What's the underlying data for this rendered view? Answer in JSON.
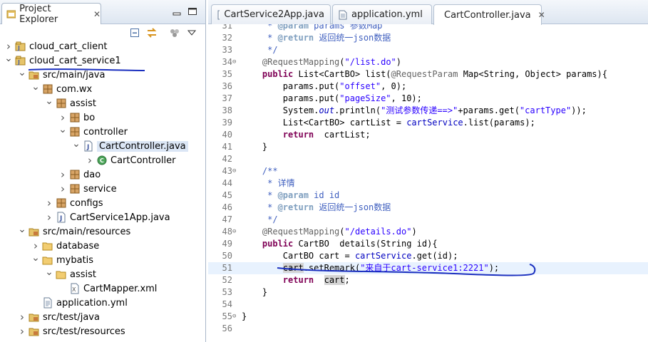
{
  "explorer": {
    "title": "Project Explorer",
    "tree": [
      {
        "label": "cloud_cart_client",
        "depth": 0,
        "arrow": "collapsed",
        "icon": "project-icon"
      },
      {
        "label": "cloud_cart_service1",
        "depth": 0,
        "arrow": "expanded",
        "icon": "project-icon"
      },
      {
        "label": "src/main/java",
        "depth": 1,
        "arrow": "expanded",
        "icon": "source-folder-icon"
      },
      {
        "label": "com.wx",
        "depth": 2,
        "arrow": "expanded",
        "icon": "package-icon"
      },
      {
        "label": "assist",
        "depth": 3,
        "arrow": "expanded",
        "icon": "package-icon"
      },
      {
        "label": "bo",
        "depth": 4,
        "arrow": "collapsed",
        "icon": "package-icon"
      },
      {
        "label": "controller",
        "depth": 4,
        "arrow": "expanded",
        "icon": "package-icon"
      },
      {
        "label": "CartController.java",
        "depth": 5,
        "arrow": "expanded",
        "icon": "java-file-icon",
        "selected": true
      },
      {
        "label": "CartController",
        "depth": 6,
        "arrow": "collapsed",
        "icon": "class-icon"
      },
      {
        "label": "dao",
        "depth": 4,
        "arrow": "collapsed",
        "icon": "package-icon"
      },
      {
        "label": "service",
        "depth": 4,
        "arrow": "collapsed",
        "icon": "package-icon"
      },
      {
        "label": "configs",
        "depth": 3,
        "arrow": "collapsed",
        "icon": "package-icon"
      },
      {
        "label": "CartService1App.java",
        "depth": 3,
        "arrow": "collapsed",
        "icon": "java-file-icon"
      },
      {
        "label": "src/main/resources",
        "depth": 1,
        "arrow": "expanded",
        "icon": "source-folder-icon"
      },
      {
        "label": "database",
        "depth": 2,
        "arrow": "collapsed",
        "icon": "folder-icon"
      },
      {
        "label": "mybatis",
        "depth": 2,
        "arrow": "expanded",
        "icon": "folder-icon"
      },
      {
        "label": "assist",
        "depth": 3,
        "arrow": "expanded",
        "icon": "folder-icon"
      },
      {
        "label": "CartMapper.xml",
        "depth": 4,
        "arrow": "none",
        "icon": "xml-file-icon"
      },
      {
        "label": "application.yml",
        "depth": 2,
        "arrow": "none",
        "icon": "yml-file-icon"
      },
      {
        "label": "src/test/java",
        "depth": 1,
        "arrow": "collapsed",
        "icon": "source-folder-icon"
      },
      {
        "label": "src/test/resources",
        "depth": 1,
        "arrow": "collapsed",
        "icon": "source-folder-icon"
      }
    ]
  },
  "editor": {
    "tabs": [
      {
        "label": "CartService2App.java",
        "icon": "java-file-icon",
        "active": false
      },
      {
        "label": "application.yml",
        "icon": "yml-file-icon",
        "active": false
      },
      {
        "label": "CartController.java",
        "icon": "java-file-icon",
        "active": true
      }
    ],
    "lines": [
      {
        "n": "31",
        "html": "     <span class=\"cm\">* </span><span class=\"tag\">@param</span><span class=\"cm\"> params 参数Map</span>"
      },
      {
        "n": "32",
        "html": "     <span class=\"cm\">* </span><span class=\"tag\">@return</span><span class=\"cm\"> 返回统一json数据</span>"
      },
      {
        "n": "33",
        "html": "     <span class=\"cm\">*/</span>"
      },
      {
        "n": "34",
        "fold": true,
        "html": "    <span class=\"ann\">@RequestMapping</span>(<span class=\"str\">\"/list.do\"</span>)"
      },
      {
        "n": "35",
        "html": "    <span class=\"kw\">public</span> List&lt;CartBO&gt; list(<span class=\"ann\">@RequestParam</span> Map&lt;String, Object&gt; params){"
      },
      {
        "n": "36",
        "html": "        params.put(<span class=\"str\">\"offset\"</span>, 0);"
      },
      {
        "n": "37",
        "html": "        params.put(<span class=\"str\">\"pageSize\"</span>, 10);"
      },
      {
        "n": "38",
        "html": "        System.<span class=\"fld\">out</span>.println(<span class=\"str\">\"测试参数传递==&gt;\"</span>+params.get(<span class=\"str\">\"cartType\"</span>));"
      },
      {
        "n": "39",
        "html": "        List&lt;CartBO&gt; cartList = <span class=\"var\">cartService</span>.list(params);"
      },
      {
        "n": "40",
        "html": "        <span class=\"kw\">return</span>  cartList;"
      },
      {
        "n": "41",
        "html": "    }"
      },
      {
        "n": "42",
        "html": ""
      },
      {
        "n": "43",
        "fold": true,
        "html": "    <span class=\"cm\">/**</span>"
      },
      {
        "n": "44",
        "html": "     <span class=\"cm\">* 详情</span>"
      },
      {
        "n": "45",
        "html": "     <span class=\"cm\">* </span><span class=\"tag\">@param</span><span class=\"cm\"> id id</span>"
      },
      {
        "n": "46",
        "html": "     <span class=\"cm\">* </span><span class=\"tag\">@return</span><span class=\"cm\"> 返回统一json数据</span>"
      },
      {
        "n": "47",
        "html": "     <span class=\"cm\">*/</span>"
      },
      {
        "n": "48",
        "fold": true,
        "html": "    <span class=\"ann\">@RequestMapping</span>(<span class=\"str\">\"/details.do\"</span>)"
      },
      {
        "n": "49",
        "html": "    <span class=\"kw\">public</span> CartBO  details(String id){"
      },
      {
        "n": "50",
        "html": "        CartBO cart = <span class=\"var\">cartService</span>.get(id);"
      },
      {
        "n": "51",
        "html": "        <span class=\"hl\">cart</span>.setRemark(<span class=\"str\">\"来自于cart-service1:2221\"</span>);",
        "current": true
      },
      {
        "n": "52",
        "html": "        <span class=\"kw\">return</span>  <span class=\"hl\">cart</span>;"
      },
      {
        "n": "53",
        "html": "    }"
      },
      {
        "n": "54",
        "html": ""
      },
      {
        "n": "55",
        "fold": true,
        "html": "}"
      },
      {
        "n": "56",
        "html": ""
      }
    ]
  },
  "colors": {
    "annotation_ink": "#1a2fbf"
  }
}
